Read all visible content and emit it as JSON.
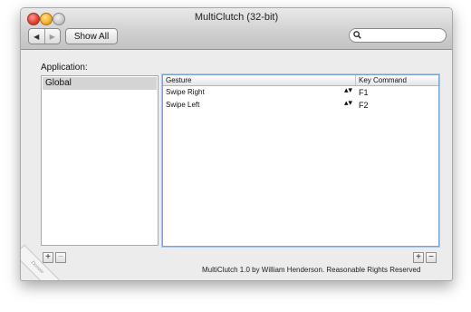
{
  "window": {
    "title": "MultiClutch (32-bit)"
  },
  "toolbar": {
    "back_glyph": "◀",
    "forward_glyph": "▶",
    "show_all_label": "Show All",
    "search_placeholder": ""
  },
  "app_panel": {
    "label": "Application:",
    "items": [
      {
        "label": "Global",
        "selected": true
      }
    ]
  },
  "gestures_table": {
    "columns": [
      "Gesture",
      "Key Command"
    ],
    "rows": [
      {
        "gesture": "Swipe Right",
        "key": "F1"
      },
      {
        "gesture": "Swipe Left",
        "key": "F2"
      }
    ],
    "stepper_glyph": "▴▾"
  },
  "buttons": {
    "add": "+",
    "remove": "−"
  },
  "footer": {
    "text": "MultiClutch 1.0 by William Henderson.  Reasonable Rights Reserved"
  },
  "badge": {
    "text": "Donate"
  },
  "colors": {
    "selection": "#d4d4d4",
    "focus_ring": "#79a3d2"
  },
  "icons": [
    "close-icon",
    "minimize-icon",
    "zoom-icon",
    "back-arrow-icon",
    "forward-arrow-icon",
    "search-icon"
  ]
}
